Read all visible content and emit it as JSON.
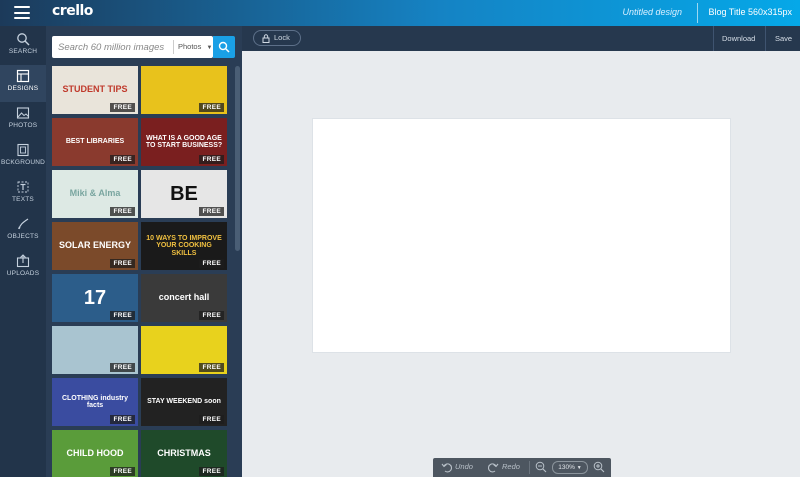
{
  "app": {
    "logo": "crello",
    "document_name": "Untitled design",
    "document_size": "Blog Title 560x315px"
  },
  "rail": {
    "items": [
      {
        "label": "SEARCH",
        "icon": "search-icon"
      },
      {
        "label": "DESIGNS",
        "icon": "designs-icon",
        "active": true
      },
      {
        "label": "PHOTOS",
        "icon": "photos-icon"
      },
      {
        "label": "BCKGROUND",
        "icon": "background-icon"
      },
      {
        "label": "TEXTS",
        "icon": "texts-icon"
      },
      {
        "label": "OBJECTS",
        "icon": "objects-icon"
      },
      {
        "label": "UPLOADS",
        "icon": "uploads-icon"
      }
    ]
  },
  "search": {
    "placeholder": "Search 60 million images",
    "source": "Photos"
  },
  "templates": [
    {
      "text": "STUDENT TIPS",
      "badge": "FREE",
      "bg": "#e9e4da",
      "color": "#c0392b"
    },
    {
      "text": "",
      "badge": "FREE",
      "bg": "#e8c21c",
      "color": "#222"
    },
    {
      "text": "BEST LIBRARIES",
      "badge": "FREE",
      "bg": "#8a3a2e",
      "color": "#fff"
    },
    {
      "text": "WHAT IS A GOOD AGE TO START BUSINESS?",
      "badge": "FREE",
      "bg": "#7a1f1f",
      "color": "#fff"
    },
    {
      "text": "Miki & Alma",
      "badge": "FREE",
      "bg": "#dde9e4",
      "color": "#7aa6a0"
    },
    {
      "text": "BE",
      "badge": "FREE",
      "bg": "#e6e6e6",
      "color": "#111"
    },
    {
      "text": "SOLAR ENERGY",
      "badge": "FREE",
      "bg": "#7b4a2a",
      "color": "#fff"
    },
    {
      "text": "10 WAYS TO IMPROVE YOUR COOKING SKILLS",
      "badge": "FREE",
      "bg": "#1a1a1a",
      "color": "#f0c040"
    },
    {
      "text": "17",
      "badge": "FREE",
      "bg": "#2c5d8a",
      "color": "#fff"
    },
    {
      "text": "concert hall",
      "badge": "FREE",
      "bg": "#3a3a3a",
      "color": "#fff"
    },
    {
      "text": "",
      "badge": "FREE",
      "bg": "#a9c4d0",
      "color": "#222"
    },
    {
      "text": "",
      "badge": "FREE",
      "bg": "#e8d21d",
      "color": "#222"
    },
    {
      "text": "CLOTHING industry facts",
      "badge": "FREE",
      "bg": "#3a4ca0",
      "color": "#fff"
    },
    {
      "text": "STAY WEEKEND soon",
      "badge": "FREE",
      "bg": "#222",
      "color": "#fff"
    },
    {
      "text": "CHILD HOOD",
      "badge": "FREE",
      "bg": "#5a9c3a",
      "color": "#fff"
    },
    {
      "text": "CHRISTMAS",
      "badge": "FREE",
      "bg": "#1f4a2a",
      "color": "#fff"
    }
  ],
  "toolbar": {
    "lock": "Lock",
    "download": "Download",
    "save": "Save"
  },
  "bottom": {
    "undo": "Undo",
    "redo": "Redo",
    "zoom": "130%"
  }
}
